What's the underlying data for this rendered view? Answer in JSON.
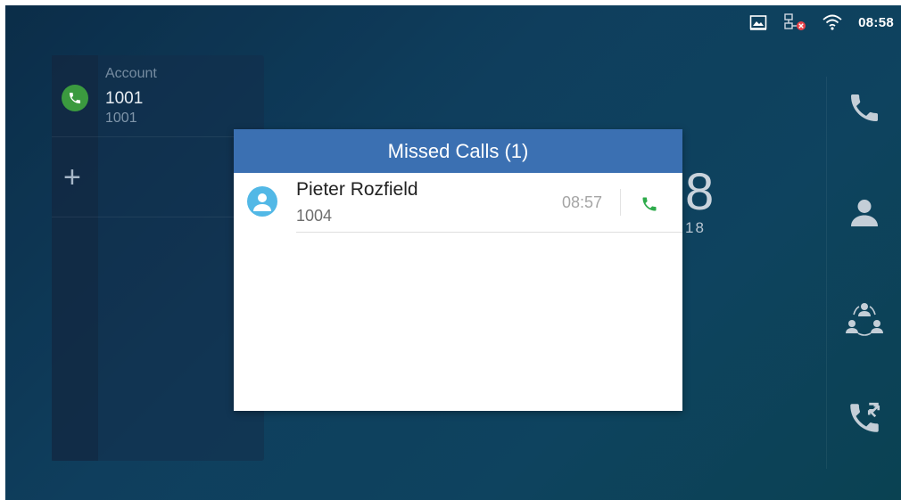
{
  "status_bar": {
    "time": "08:58",
    "icons": [
      "screenshot-icon",
      "network-disconnected-icon",
      "wifi-icon"
    ]
  },
  "account_panel": {
    "label": "Account",
    "number": "1001",
    "sub_number": "1001",
    "add_icon": "+"
  },
  "background_clock": {
    "time_fragment": "8",
    "date_fragment": "18"
  },
  "missed_calls_dialog": {
    "title": "Missed Calls (1)",
    "items": [
      {
        "name": "Pieter Rozfield",
        "number": "1004",
        "time": "08:57"
      }
    ]
  },
  "right_toolbar": {
    "buttons": [
      "phone-icon",
      "contacts-icon",
      "conference-icon",
      "call-history-icon"
    ]
  },
  "colors": {
    "dialog_header": "#3b70b2",
    "callback_green": "#2eab4b",
    "avatar_blue": "#52b8e6",
    "account_green": "#3b9a3f"
  }
}
